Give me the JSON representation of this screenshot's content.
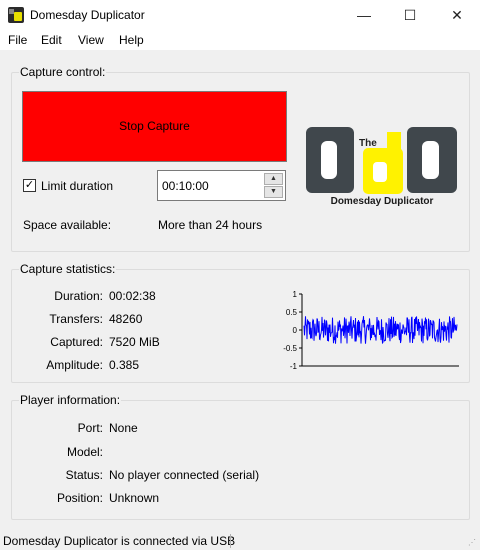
{
  "window": {
    "title": "Domesday Duplicator",
    "minimize_glyph": "—",
    "maximize_glyph": "☐",
    "close_glyph": "✕"
  },
  "menu": [
    "File",
    "Edit",
    "View",
    "Help"
  ],
  "capture_control": {
    "title": "Capture control:",
    "stop_button": "Stop Capture",
    "stop_button_color": "#ff0000",
    "limit_checked": true,
    "limit_label": "Limit duration",
    "duration_value": "00:10:00",
    "space_label": "Space available:",
    "space_value": "More than 24 hours",
    "logo": {
      "small": "The",
      "big": "DdD",
      "caption": "Domesday Duplicator"
    }
  },
  "capture_statistics": {
    "title": "Capture statistics:",
    "duration_label": "Duration:",
    "duration_value": "00:02:38",
    "transfers_label": "Transfers:",
    "transfers_value": "48260",
    "captured_label": "Captured:",
    "captured_value": "7520 MiB",
    "amplitude_label": "Amplitude:",
    "amplitude_value": "0.385"
  },
  "chart_data": {
    "type": "line",
    "y_ticks": [
      "1",
      "0.5",
      "0",
      "-0.5",
      "-1"
    ],
    "ylim": [
      -1,
      1
    ],
    "series_color": "#0000ff",
    "amplitude": 0.385,
    "grid": false
  },
  "player_information": {
    "title": "Player information:",
    "port_label": "Port:",
    "port_value": "None",
    "model_label": "Model:",
    "model_value": "",
    "status_label": "Status:",
    "status_value": "No player connected (serial)",
    "position_label": "Position:",
    "position_value": "Unknown"
  },
  "statusbar": {
    "text": "Domesday Duplicator is connected via USB"
  }
}
